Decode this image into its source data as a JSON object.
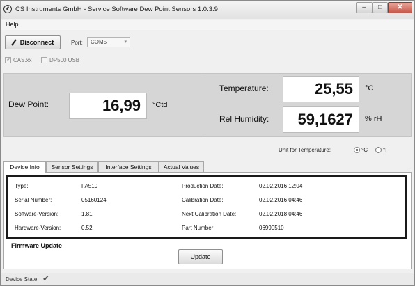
{
  "window": {
    "title": "CS Instruments GmbH - Service Software Dew Point Sensors  1.0.3.9",
    "minimize_glyph": "–",
    "maximize_glyph": "□",
    "close_glyph": "✕"
  },
  "menu": {
    "help": "Help"
  },
  "toolbar": {
    "disconnect_label": "Disconnect",
    "port_label": "Port:",
    "port_value": "COM5",
    "port_caret": "▾"
  },
  "checkboxes": [
    {
      "label": "CAS.xx",
      "checked": true
    },
    {
      "label": "DP500 USB",
      "checked": false
    }
  ],
  "check_glyph": "✓",
  "measurements": {
    "dew_point": {
      "label": "Dew Point:",
      "value": "16,99",
      "unit": "°Ctd"
    },
    "temperature": {
      "label": "Temperature:",
      "value": "25,55",
      "unit": "°C"
    },
    "humidity": {
      "label": "Rel Humidity:",
      "value": "59,1627",
      "unit": "% rH"
    }
  },
  "temperature_unit": {
    "label": "Unit for Temperature:",
    "options": [
      {
        "label": "°C",
        "selected": true
      },
      {
        "label": "°F",
        "selected": false
      }
    ]
  },
  "tabs": [
    {
      "label": "Device Info",
      "active": true
    },
    {
      "label": "Sensor Settings",
      "active": false
    },
    {
      "label": "Interface Settings",
      "active": false
    },
    {
      "label": "Actual Values",
      "active": false
    }
  ],
  "device_info": {
    "left": [
      {
        "label": "Type:",
        "value": "FA510"
      },
      {
        "label": "Serial Number:",
        "value": "05160124"
      },
      {
        "label": "Software-Version:",
        "value": "1.81"
      },
      {
        "label": "Hardware-Version:",
        "value": "0.52"
      }
    ],
    "right": [
      {
        "label": "Production Date:",
        "value": "02.02.2016 12:04"
      },
      {
        "label": "Calibration Date:",
        "value": "02.02.2016 04:46"
      },
      {
        "label": "Next Calibration Date:",
        "value": "02.02.2018 04:46"
      },
      {
        "label": "Part Number:",
        "value": "06990510"
      }
    ]
  },
  "firmware": {
    "title": "Firmware Update",
    "update_label": "Update"
  },
  "status": {
    "label": "Device State:",
    "icon": "checkmark-icon",
    "glyph": "✔"
  }
}
